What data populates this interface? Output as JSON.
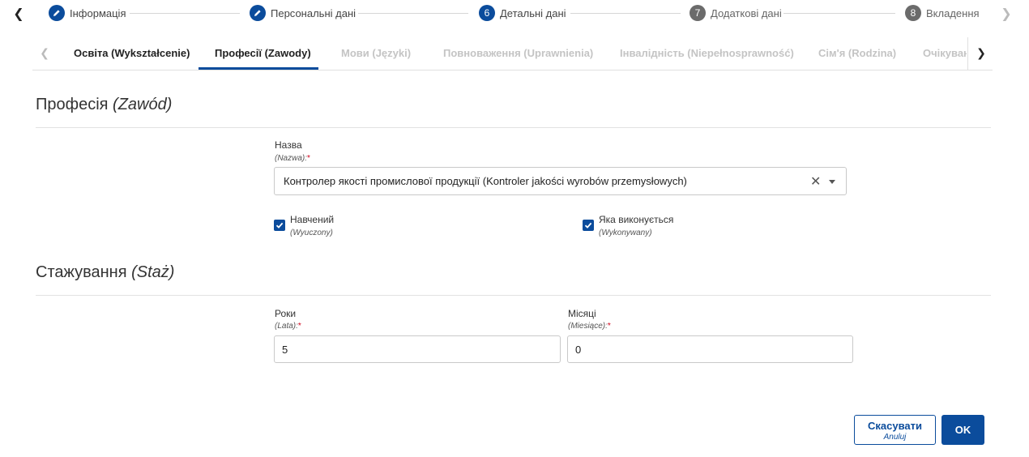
{
  "stepper": {
    "steps": [
      {
        "number": "",
        "label": "Інформація",
        "state": "done"
      },
      {
        "number": "",
        "label": "Персональні дані",
        "state": "done"
      },
      {
        "number": "6",
        "label": "Детальні дані",
        "state": "active"
      },
      {
        "number": "7",
        "label": "Додаткові дані",
        "state": "pending"
      },
      {
        "number": "8",
        "label": "Вкладення",
        "state": "pending"
      }
    ]
  },
  "tabs": [
    {
      "label": "Освіта (Wykształcenie)",
      "state": "enabled"
    },
    {
      "label": "Професії (Zawody)",
      "state": "selected"
    },
    {
      "label": "Мови (Języki)",
      "state": "disabled"
    },
    {
      "label": "Повноваження (Uprawnienia)",
      "state": "disabled"
    },
    {
      "label": "Інвалідність (Niepełnosprawność)",
      "state": "disabled"
    },
    {
      "label": "Сім'я (Rodzina)",
      "state": "disabled"
    },
    {
      "label": "Очікування",
      "state": "disabled"
    }
  ],
  "profession": {
    "title": "Професія",
    "title_italic": "(Zawód)",
    "name_label": "Назва",
    "name_sublabel": "(Nazwa):",
    "required_mark": "*",
    "name_value": "Контролер якості промислової продукції (Kontroler jakości wyrobów przemysłowych)",
    "trained_label": "Навчений",
    "trained_sublabel": "(Wyuczony)",
    "trained_checked": true,
    "performed_label": "Яка виконується",
    "performed_sublabel": "(Wykonywany)",
    "performed_checked": true
  },
  "seniority": {
    "title": "Стажування",
    "title_italic": "(Staż)",
    "years_label": "Роки",
    "years_sublabel": "(Lata):",
    "years_value": "5",
    "months_label": "Місяці",
    "months_sublabel": "(Miesiące):",
    "months_value": "0",
    "required_mark": "*"
  },
  "buttons": {
    "cancel_label": "Скасувати",
    "cancel_sublabel": "Anuluj",
    "ok_label": "OK"
  },
  "colors": {
    "accent": "#0b4c9c",
    "required": "#d0021b"
  }
}
